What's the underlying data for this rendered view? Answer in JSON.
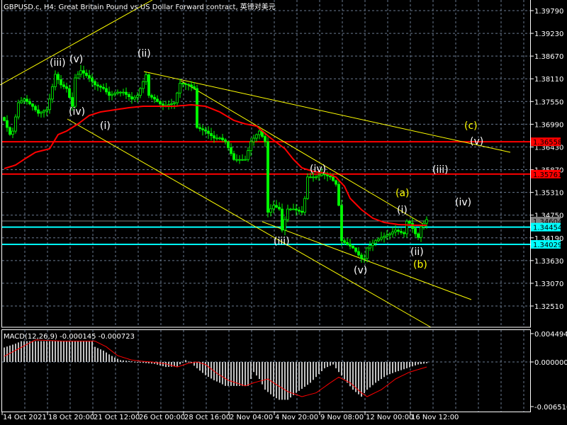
{
  "header": {
    "title": "GBPUSD.c, H4:  Great Britain Pound vs US Dollar Forward contract, 英镑对美元"
  },
  "colors": {
    "bull": "#00ff00",
    "ma": "#ff0000",
    "level_red": "#ff0000",
    "level_cyan": "#00ffff",
    "trend": "#ffff00",
    "hist": "#c0c0c0",
    "signal": "#ff0000"
  },
  "chart_data": [
    {
      "type": "candlestick",
      "title": "GBPUSD.c, H4",
      "ylim": [
        1.3251,
        1.3979
      ],
      "price_ticks": [
        "1.39790",
        "1.39230",
        "1.38670",
        "1.38110",
        "1.37550",
        "1.36990",
        "1.36430",
        "1.35870",
        "1.35310",
        "1.34750",
        "1.34190",
        "1.33630",
        "1.33070",
        "1.32510"
      ],
      "x_tick_labels": [
        "14 Oct 2021",
        "18 Oct 20:00",
        "21 Oct 12:00",
        "26 Oct 00:00",
        "28 Oct 16:00",
        "2 Nov 04:00",
        "4 Nov 20:00",
        "9 Nov 08:00",
        "12 Nov 00:00",
        "16 Nov 12:00"
      ],
      "bar_count": 150,
      "close_waypoints": [
        [
          0,
          1.3708
        ],
        [
          2,
          1.3674
        ],
        [
          3,
          1.3682
        ],
        [
          5,
          1.3752
        ],
        [
          7,
          1.3761
        ],
        [
          10,
          1.3743
        ],
        [
          12,
          1.3726
        ],
        [
          15,
          1.3735
        ],
        [
          16,
          1.3761
        ],
        [
          18,
          1.3822
        ],
        [
          20,
          1.3796
        ],
        [
          22,
          1.3787
        ],
        [
          24,
          1.3743
        ],
        [
          25,
          1.3813
        ],
        [
          27,
          1.3831
        ],
        [
          30,
          1.3813
        ],
        [
          32,
          1.3796
        ],
        [
          35,
          1.3787
        ],
        [
          37,
          1.377
        ],
        [
          40,
          1.3778
        ],
        [
          42,
          1.3778
        ],
        [
          45,
          1.3761
        ],
        [
          47,
          1.377
        ],
        [
          50,
          1.3821
        ],
        [
          51,
          1.377
        ],
        [
          53,
          1.3761
        ],
        [
          56,
          1.3743
        ],
        [
          60,
          1.3752
        ],
        [
          62,
          1.38
        ],
        [
          65,
          1.3796
        ],
        [
          67,
          1.3787
        ],
        [
          68,
          1.3691
        ],
        [
          71,
          1.3682
        ],
        [
          74,
          1.3665
        ],
        [
          76,
          1.3665
        ],
        [
          78,
          1.3656
        ],
        [
          81,
          1.3612
        ],
        [
          85,
          1.3612
        ],
        [
          87,
          1.3656
        ],
        [
          90,
          1.3682
        ],
        [
          92,
          1.3656
        ],
        [
          93,
          1.3482
        ],
        [
          95,
          1.3499
        ],
        [
          97,
          1.349
        ],
        [
          98,
          1.3438
        ],
        [
          100,
          1.349
        ],
        [
          102,
          1.349
        ],
        [
          105,
          1.3482
        ],
        [
          106,
          1.3516
        ],
        [
          107,
          1.3569
        ],
        [
          110,
          1.3569
        ],
        [
          112,
          1.3577
        ],
        [
          115,
          1.3569
        ],
        [
          117,
          1.3551
        ],
        [
          118,
          1.3499
        ],
        [
          119,
          1.3412
        ],
        [
          121,
          1.3403
        ],
        [
          123,
          1.3394
        ],
        [
          126,
          1.3368
        ],
        [
          127,
          1.3368
        ],
        [
          128,
          1.3394
        ],
        [
          131,
          1.3412
        ],
        [
          133,
          1.342
        ],
        [
          136,
          1.3429
        ],
        [
          138,
          1.3438
        ],
        [
          141,
          1.3429
        ],
        [
          142,
          1.346
        ],
        [
          143,
          1.3455
        ],
        [
          145,
          1.3429
        ],
        [
          146,
          1.342
        ],
        [
          147,
          1.3446
        ],
        [
          149,
          1.3464
        ]
      ],
      "moving_average_waypoints": [
        [
          0,
          1.35897
        ],
        [
          4,
          1.35984
        ],
        [
          7,
          1.36124
        ],
        [
          11,
          1.36298
        ],
        [
          16,
          1.36386
        ],
        [
          19,
          1.36735
        ],
        [
          22,
          1.36822
        ],
        [
          26,
          1.36997
        ],
        [
          30,
          1.37206
        ],
        [
          34,
          1.37294
        ],
        [
          39,
          1.37346
        ],
        [
          44,
          1.37398
        ],
        [
          49,
          1.37433
        ],
        [
          54,
          1.37433
        ],
        [
          60,
          1.37433
        ],
        [
          66,
          1.37468
        ],
        [
          71,
          1.37433
        ],
        [
          76,
          1.37294
        ],
        [
          81,
          1.37084
        ],
        [
          85,
          1.36997
        ],
        [
          89,
          1.36944
        ],
        [
          91,
          1.36822
        ],
        [
          94,
          1.36648
        ],
        [
          99,
          1.36386
        ],
        [
          102,
          1.36124
        ],
        [
          105,
          1.35914
        ],
        [
          109,
          1.35827
        ],
        [
          114,
          1.35775
        ],
        [
          117,
          1.35687
        ],
        [
          120,
          1.3546
        ],
        [
          122,
          1.35164
        ],
        [
          126,
          1.34885
        ],
        [
          130,
          1.34675
        ],
        [
          134,
          1.3457
        ],
        [
          139,
          1.34518
        ],
        [
          145,
          1.345
        ]
      ],
      "levels": [
        {
          "price": "1.36558",
          "color": "#ff0000"
        },
        {
          "price": "1.35761",
          "color": "#ff0000"
        },
        {
          "price": "1.34604",
          "color": "#808080"
        },
        {
          "price": "1.34454",
          "color": "#00ffff"
        },
        {
          "price": "1.34029",
          "color": "#00ffff"
        }
      ],
      "wave_labels": [
        {
          "text": "(iii)",
          "color": "white"
        },
        {
          "text": "(v)",
          "color": "white"
        },
        {
          "text": "(ii)",
          "color": "white"
        },
        {
          "text": "(iv)",
          "color": "white"
        },
        {
          "text": "(i)",
          "color": "white"
        },
        {
          "text": "(iii)",
          "color": "white"
        },
        {
          "text": "(iv)",
          "color": "white"
        },
        {
          "text": "(v)",
          "color": "white"
        },
        {
          "text": "(a)",
          "color": "yellow"
        },
        {
          "text": "(i)",
          "color": "white"
        },
        {
          "text": "(ii)",
          "color": "white"
        },
        {
          "text": "(b)",
          "color": "yellow"
        },
        {
          "text": "(c)",
          "color": "yellow"
        },
        {
          "text": "(v)",
          "color": "white"
        },
        {
          "text": "(iii)",
          "color": "white"
        },
        {
          "text": "(iv)",
          "color": "white"
        }
      ]
    },
    {
      "type": "bar",
      "title": "MACD(12,26,9) -0.000145 -0.000723",
      "ylim": [
        -0.00651,
        0.004494
      ],
      "ticks": [
        "0.004494",
        "0.000000",
        "-0.006510"
      ],
      "histogram_waypoints": [
        [
          0,
          0.0023
        ],
        [
          4,
          0.0029
        ],
        [
          6,
          0.0033
        ],
        [
          31,
          0.0033
        ],
        [
          32,
          0.0024
        ],
        [
          35,
          0.0018
        ],
        [
          37,
          0.0012
        ],
        [
          39,
          0.0007
        ],
        [
          41,
          0.0003
        ],
        [
          45,
          0.0001
        ],
        [
          48,
          -0.0001
        ],
        [
          53,
          -0.0003
        ],
        [
          57,
          -0.0008
        ],
        [
          61,
          -0.0007
        ],
        [
          64,
          0.0003
        ],
        [
          66,
          -0.0002
        ],
        [
          68,
          -0.001
        ],
        [
          71,
          -0.0021
        ],
        [
          74,
          -0.0029
        ],
        [
          76,
          -0.0033
        ],
        [
          78,
          -0.0038
        ],
        [
          86,
          -0.0038
        ],
        [
          88,
          -0.0016
        ],
        [
          90,
          -0.0027
        ],
        [
          92,
          -0.0044
        ],
        [
          95,
          -0.0055
        ],
        [
          97,
          -0.006
        ],
        [
          100,
          -0.006
        ],
        [
          103,
          -0.0049
        ],
        [
          108,
          -0.0033
        ],
        [
          113,
          -0.001
        ],
        [
          116,
          -0.0004
        ],
        [
          118,
          -0.0016
        ],
        [
          121,
          -0.0033
        ],
        [
          123,
          -0.0044
        ],
        [
          126,
          -0.0055
        ],
        [
          128,
          -0.0044
        ],
        [
          131,
          -0.0033
        ],
        [
          135,
          -0.0021
        ],
        [
          138,
          -0.0016
        ],
        [
          142,
          -0.001
        ],
        [
          146,
          -0.0004
        ],
        [
          149,
          -0.0002
        ]
      ],
      "signal_waypoints": [
        [
          0,
          0.0009
        ],
        [
          11,
          0.0035
        ],
        [
          21,
          0.0033
        ],
        [
          32,
          0.0033
        ],
        [
          36,
          0.0024
        ],
        [
          40,
          0.001
        ],
        [
          45,
          0.0003
        ],
        [
          49,
          0.0001
        ],
        [
          52,
          0
        ],
        [
          57,
          -0.0003
        ],
        [
          61,
          -0.0008
        ],
        [
          65,
          -0.0002
        ],
        [
          68,
          0
        ],
        [
          71,
          -0.0004
        ],
        [
          75,
          -0.0018
        ],
        [
          79,
          -0.0029
        ],
        [
          85,
          -0.0038
        ],
        [
          88,
          -0.0033
        ],
        [
          93,
          -0.0027
        ],
        [
          95,
          -0.0033
        ],
        [
          100,
          -0.0047
        ],
        [
          105,
          -0.0055
        ],
        [
          110,
          -0.0049
        ],
        [
          115,
          -0.0033
        ],
        [
          118,
          -0.0024
        ],
        [
          122,
          -0.0033
        ],
        [
          126,
          -0.0049
        ],
        [
          128,
          -0.0055
        ],
        [
          133,
          -0.0044
        ],
        [
          138,
          -0.0027
        ],
        [
          143,
          -0.0016
        ],
        [
          149,
          -0.0008
        ]
      ]
    }
  ]
}
